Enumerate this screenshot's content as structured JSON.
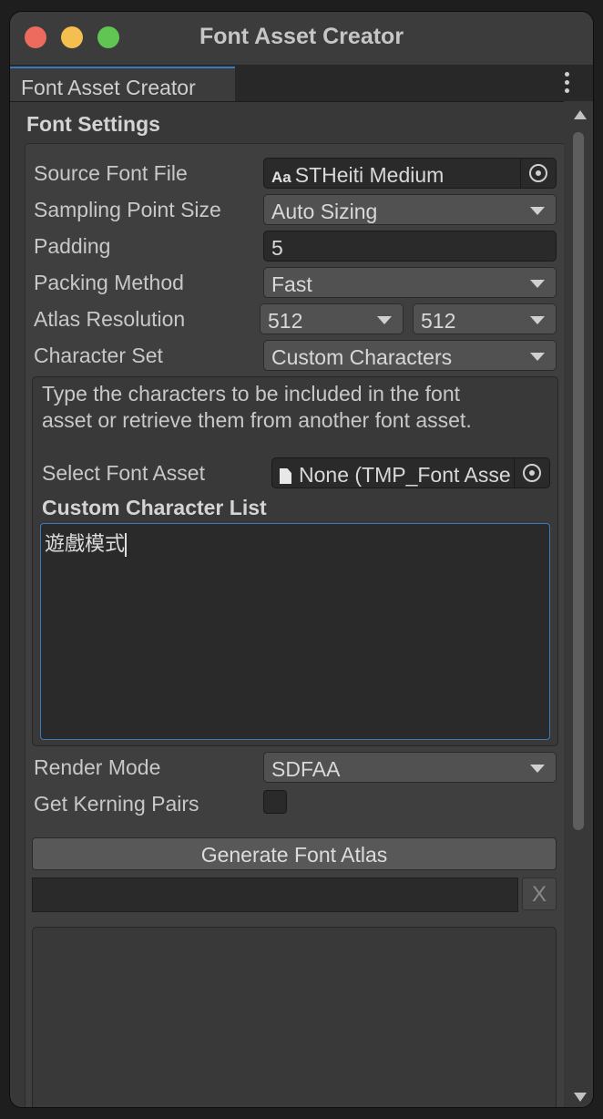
{
  "window": {
    "title": "Font Asset Creator"
  },
  "tab": {
    "label": "Font Asset Creator"
  },
  "font_settings": {
    "section_title": "Font Settings",
    "source_font_file": {
      "label": "Source Font File",
      "value": "STHeiti Medium",
      "icon": "font-aa-icon"
    },
    "sampling_point_size": {
      "label": "Sampling Point Size",
      "value": "Auto Sizing"
    },
    "padding": {
      "label": "Padding",
      "value": "5"
    },
    "packing_method": {
      "label": "Packing Method",
      "value": "Fast"
    },
    "atlas_resolution": {
      "label": "Atlas Resolution",
      "width": "512",
      "height": "512"
    },
    "character_set": {
      "label": "Character Set",
      "value": "Custom Characters"
    },
    "custom_chars": {
      "help_text": "Type the characters to be included in the font asset or retrieve them from another font asset.",
      "select_font_asset_label": "Select Font Asset",
      "select_font_asset_value": "None (TMP_Font Asse",
      "list_label": "Custom Character List",
      "list_value": "遊戲模式"
    },
    "render_mode": {
      "label": "Render Mode",
      "value": "SDFAA"
    },
    "get_kerning_pairs": {
      "label": "Get Kerning Pairs",
      "checked": false
    }
  },
  "actions": {
    "generate_label": "Generate Font Atlas",
    "progress": 0,
    "clear_label": "X"
  },
  "colors": {
    "accent": "#3a79bb",
    "close": "#ed6a5e",
    "minimize": "#f5bf4f",
    "zoom": "#61c554"
  }
}
